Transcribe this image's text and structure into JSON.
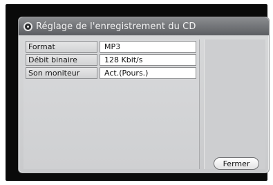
{
  "dialog": {
    "title": "Réglage de l'enregistrement du CD",
    "icon": "settings-disc-icon"
  },
  "settings": [
    {
      "label": "Format",
      "value": "MP3"
    },
    {
      "label": "Débit binaire",
      "value": "128 Kbit/s"
    },
    {
      "label": "Son moniteur",
      "value": "Act.(Pours.)"
    }
  ],
  "buttons": {
    "close_label": "Fermer"
  },
  "colors": {
    "screen_bg": "#0a0a0a",
    "dialog_bg": "#d9dadb",
    "titlebar": "#6e7074",
    "value_bg": "#ffffff"
  }
}
